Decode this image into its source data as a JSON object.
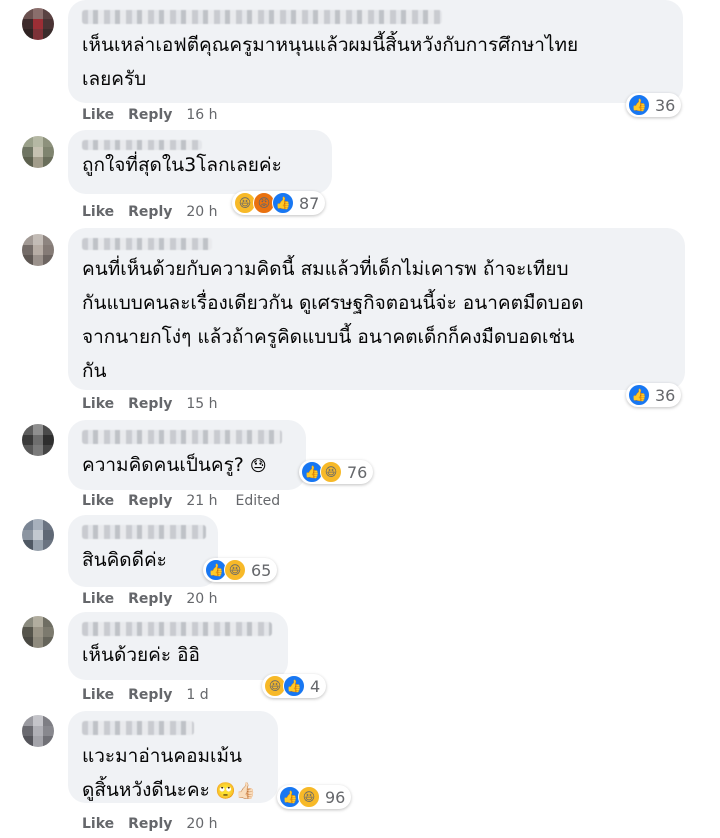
{
  "labels": {
    "like": "Like",
    "reply": "Reply",
    "edited": "Edited"
  },
  "comments": [
    {
      "text": "เห็นเหล่าเอฟตีคุณครูมาหนุนแล้วผมนี้สิ้นหวังกับการศึกษาไทย\nเลยครับ",
      "time": "16 h",
      "reactions": [
        "like"
      ],
      "count": "36"
    },
    {
      "text": "ถูกใจที่สุดใน3โลกเลยค่ะ",
      "time": "20 h",
      "reactions": [
        "haha",
        "angry",
        "like"
      ],
      "count": "87"
    },
    {
      "text": "คนที่เห็นด้วยกับความคิดนี้ สมแล้วที่เด็กไม่เคารพ ถ้าจะเทียบ\nกันแบบคนละเรื่องเดียวกัน ดูเศรษฐกิจตอนนี้จ่ะ อนาคตมืดบอด\nจากนายกโง่ๆ แล้วถ้าครูคิดแบบนี้ อนาคตเด็กก็คงมืดบอดเช่น\nกัน",
      "time": "15 h",
      "reactions": [
        "like"
      ],
      "count": "36"
    },
    {
      "text": "ความคิดคนเป็นครู?",
      "text_emoji": "😓",
      "time": "21 h",
      "edited": true,
      "reactions": [
        "like",
        "haha"
      ],
      "count": "76"
    },
    {
      "text": "สินคิดดีค่ะ",
      "time": "20 h",
      "reactions": [
        "like",
        "haha"
      ],
      "count": "65"
    },
    {
      "text": "เห็นด้วยค่ะ อิอิ",
      "time": "1 d",
      "reactions": [
        "haha",
        "like"
      ],
      "count": "4"
    },
    {
      "text": "แวะมาอ่านคอมเม้น\nดูสิ้นหวังดีนะคะ",
      "text_emoji": "🙄👍🏻",
      "time": "20 h",
      "reactions": [
        "like",
        "haha"
      ],
      "count": "96"
    }
  ]
}
